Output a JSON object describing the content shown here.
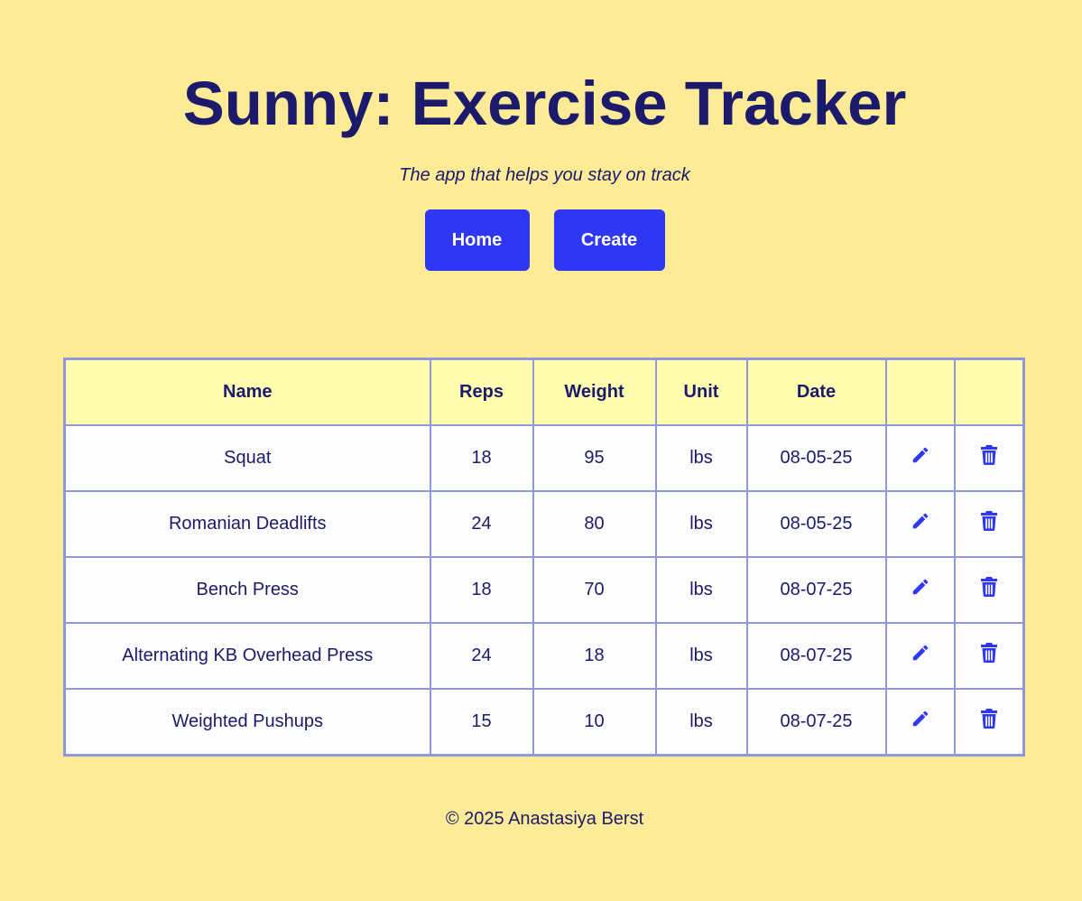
{
  "header": {
    "title": "Sunny: Exercise Tracker",
    "subtitle": "The app that helps you stay on track"
  },
  "nav": {
    "home_label": "Home",
    "create_label": "Create"
  },
  "table": {
    "columns": [
      "Name",
      "Reps",
      "Weight",
      "Unit",
      "Date",
      "",
      ""
    ],
    "rows": [
      {
        "name": "Squat",
        "reps": "18",
        "weight": "95",
        "unit": "lbs",
        "date": "08-05-25"
      },
      {
        "name": "Romanian Deadlifts",
        "reps": "24",
        "weight": "80",
        "unit": "lbs",
        "date": "08-05-25"
      },
      {
        "name": "Bench Press",
        "reps": "18",
        "weight": "70",
        "unit": "lbs",
        "date": "08-07-25"
      },
      {
        "name": "Alternating KB Overhead Press",
        "reps": "24",
        "weight": "18",
        "unit": "lbs",
        "date": "08-07-25"
      },
      {
        "name": "Weighted Pushups",
        "reps": "15",
        "weight": "10",
        "unit": "lbs",
        "date": "08-07-25"
      }
    ],
    "edit_icon": "pencil-icon",
    "delete_icon": "trash-icon"
  },
  "footer": {
    "text": "© 2025 Anastasiya Berst"
  },
  "colors": {
    "background": "#fdeb98",
    "text": "#1b1a6b",
    "button": "#2f37f2",
    "table_header_bg": "#fffdb0",
    "table_border": "#9198d8",
    "table_cell_bg": "#fdfdfd"
  }
}
